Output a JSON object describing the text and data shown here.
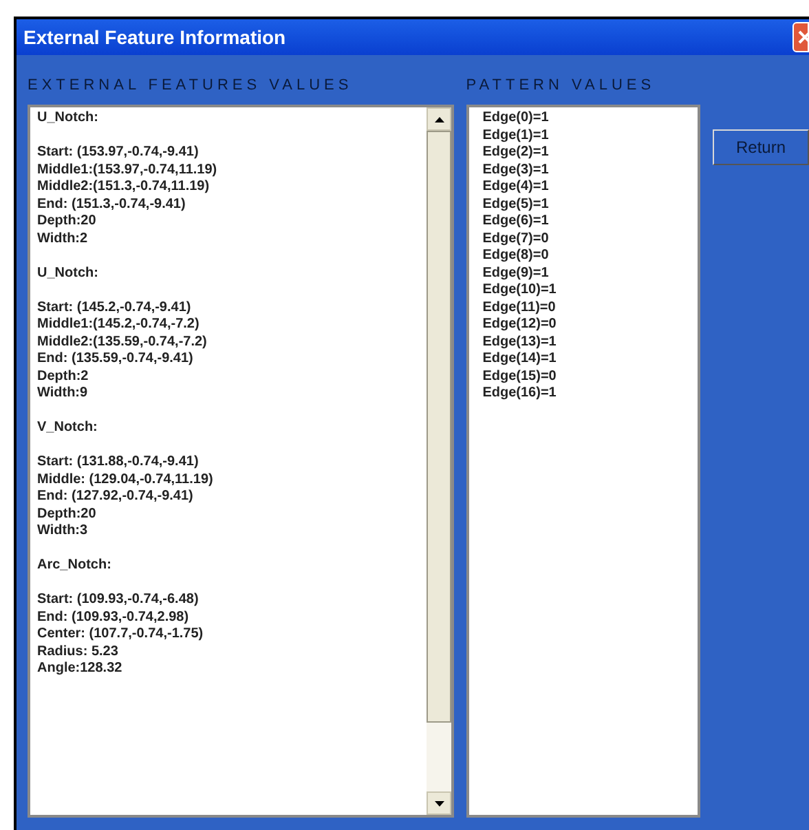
{
  "window": {
    "title": "External Feature Information"
  },
  "features_label": "EXTERNAL FEATURES VALUES",
  "pattern_label": "PATTERN VALUES",
  "features": [
    {
      "heading": "U_Notch:",
      "lines": [
        "Start: (153.97,-0.74,-9.41)",
        "Middle1:(153.97,-0.74,11.19)",
        "Middle2:(151.3,-0.74,11.19)",
        "End: (151.3,-0.74,-9.41)",
        "Depth:20",
        "Width:2"
      ]
    },
    {
      "heading": "U_Notch:",
      "lines": [
        "Start: (145.2,-0.74,-9.41)",
        "Middle1:(145.2,-0.74,-7.2)",
        "Middle2:(135.59,-0.74,-7.2)",
        "End: (135.59,-0.74,-9.41)",
        "Depth:2",
        "Width:9"
      ]
    },
    {
      "heading": "V_Notch:",
      "lines": [
        "Start: (131.88,-0.74,-9.41)",
        "Middle: (129.04,-0.74,11.19)",
        "End: (127.92,-0.74,-9.41)",
        "Depth:20",
        "Width:3"
      ]
    },
    {
      "heading": "Arc_Notch:",
      "lines": [
        "Start: (109.93,-0.74,-6.48)",
        "End: (109.93,-0.74,2.98)",
        "Center: (107.7,-0.74,-1.75)",
        "Radius: 5.23",
        "Angle:128.32"
      ]
    }
  ],
  "pattern_values": [
    "Edge(0)=1",
    "Edge(1)=1",
    "Edge(2)=1",
    "Edge(3)=1",
    "Edge(4)=1",
    "Edge(5)=1",
    "Edge(6)=1",
    "Edge(7)=0",
    "Edge(8)=0",
    "Edge(9)=1",
    "Edge(10)=1",
    "Edge(11)=0",
    "Edge(12)=0",
    "Edge(13)=1",
    "Edge(14)=1",
    "Edge(15)=0",
    "Edge(16)=1"
  ],
  "buttons": {
    "return": "Return"
  }
}
